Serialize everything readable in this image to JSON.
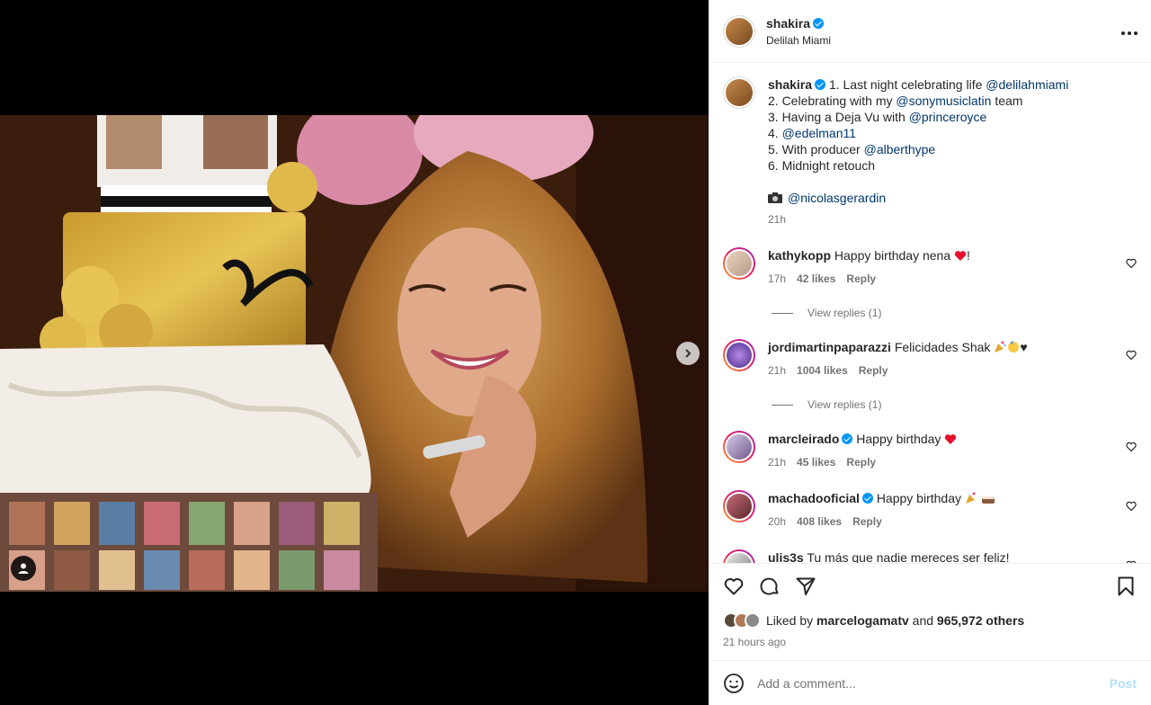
{
  "post": {
    "author": "shakira",
    "location": "Delilah Miami",
    "more_label": "•••"
  },
  "caption": {
    "author": "shakira",
    "lines": [
      {
        "prefix": "1. Last night celebrating life ",
        "mention": "@delilahmiami",
        "suffix": ""
      },
      {
        "prefix": "2. Celebrating with my ",
        "mention": "@sonymusiclatin",
        "suffix": " team"
      },
      {
        "prefix": "3. Having a Deja Vu with ",
        "mention": "@princeroyce",
        "suffix": ""
      },
      {
        "prefix": "4. ",
        "mention": "@edelman11",
        "suffix": ""
      },
      {
        "prefix": "5. With producer ",
        "mention": "@alberthype",
        "suffix": ""
      },
      {
        "prefix": "6. Midnight retouch",
        "mention": "",
        "suffix": ""
      }
    ],
    "photo_credit": "@nicolasgerardin",
    "time": "21h"
  },
  "comments": [
    {
      "user": "kathykopp",
      "text": "Happy birthday nena",
      "suffix": "!",
      "time": "17h",
      "likes": "42 likes",
      "reply": "Reply",
      "view_replies": "View replies (1)",
      "verified": false
    },
    {
      "user": "jordimartinpaparazzi",
      "text": "Felicidades Shak",
      "suffix": "♥",
      "time": "21h",
      "likes": "1004 likes",
      "reply": "Reply",
      "view_replies": "View replies (1)",
      "verified": true
    },
    {
      "user": "marcleirado",
      "text": "Happy birthday",
      "suffix": "",
      "time": "21h",
      "likes": "45 likes",
      "reply": "Reply",
      "verified": true
    },
    {
      "user": "machadooficial",
      "text": "Happy birthday",
      "suffix": "",
      "time": "20h",
      "likes": "408 likes",
      "reply": "Reply",
      "verified": true
    },
    {
      "user": "ulis3s",
      "text": "Tu más que nadie mereces ser feliz!",
      "suffix": "",
      "time": "",
      "likes": "",
      "reply": "",
      "verified": false
    }
  ],
  "likes": {
    "prefix": "Liked by ",
    "user": "marcelogamatv",
    "middle": " and ",
    "count": "965,972 others"
  },
  "posted_time": "21 hours ago",
  "add_comment": {
    "placeholder": "Add a comment...",
    "post_label": "Post"
  },
  "colors": {
    "verified": "#0095f6",
    "mention": "#00376b",
    "post_disabled": "#b2dffc",
    "muted": "#737373"
  },
  "icons": [
    "more-icon",
    "like-icon",
    "comment-icon",
    "share-icon",
    "save-icon",
    "emoji-icon",
    "next-arrow-icon",
    "user-tag-icon",
    "verified-badge-icon"
  ]
}
